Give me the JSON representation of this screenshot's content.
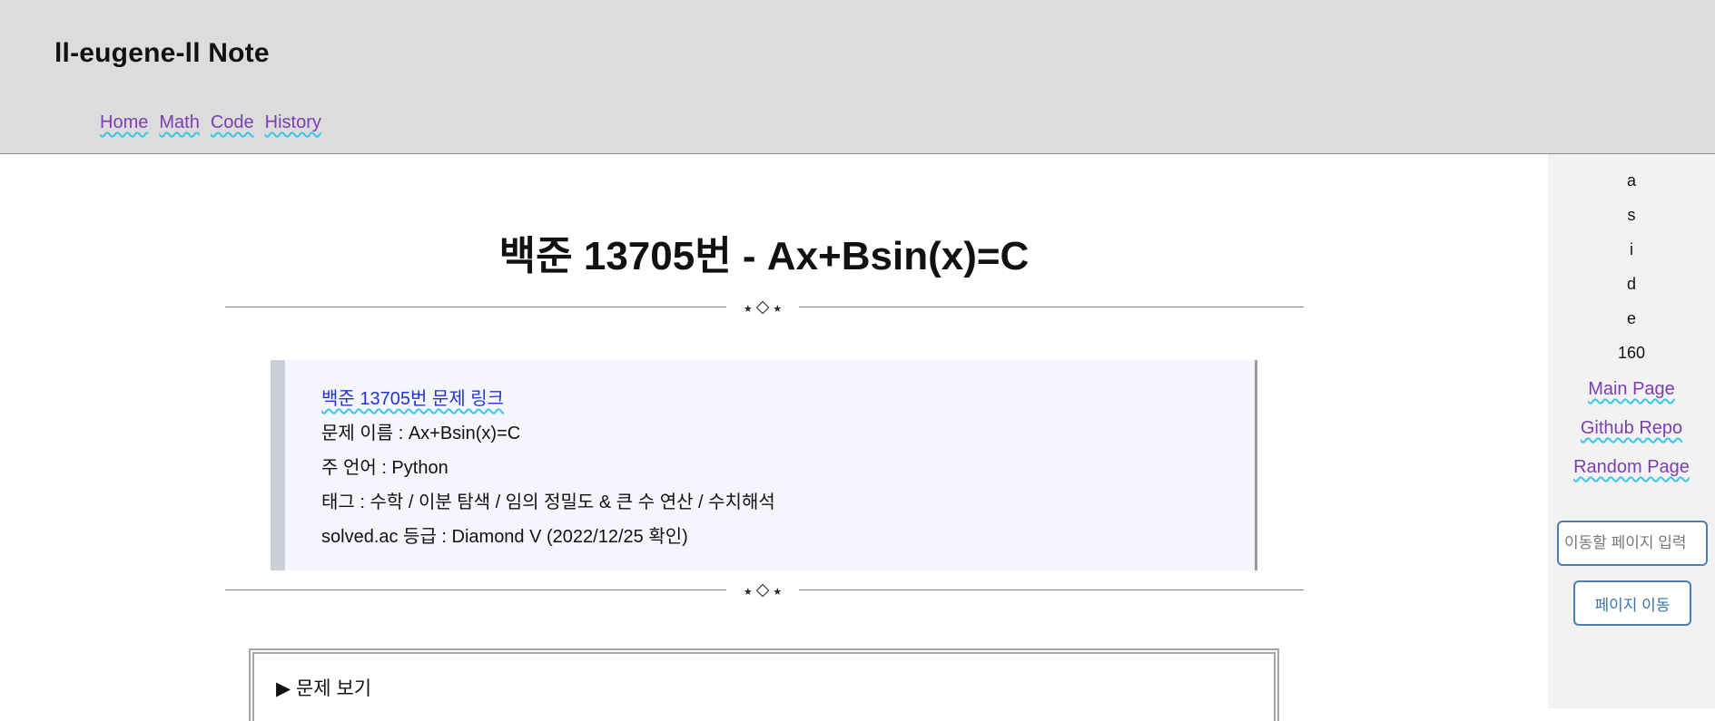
{
  "header": {
    "title": "ll-eugene-ll Note",
    "nav": [
      "Home",
      "Math",
      "Code",
      "History"
    ]
  },
  "aside": {
    "letters": [
      "a",
      "s",
      "i",
      "d",
      "e",
      "160"
    ],
    "links": [
      "Main Page",
      "Github Repo",
      "Random Page"
    ],
    "input_placeholder": "이동할 페이지 입력",
    "go_button": "페이지 이동"
  },
  "post": {
    "title": "백준 13705번 - Ax+Bsin(x)=C",
    "divider": {
      "star": "★",
      "diamond": "◇"
    },
    "info": {
      "link_text": "백준 13705번 문제 링크",
      "problem_name": "문제 이름 : Ax+Bsin(x)=C",
      "language": "주 언어 : Python",
      "tags": "태그 : 수학 / 이분 탐색 / 임의 정밀도 & 큰 수 연산 / 수치해석",
      "grade": "solved.ac 등급 : Diamond V (2022/12/25 확인)"
    },
    "details_summary": "▶ 문제 보기"
  },
  "colors": {
    "header_bg": "#dcdcdc",
    "aside_bg": "#f2f2f2",
    "link_visited": "#7b3fb0",
    "link": "#2234d8",
    "info_bg": "#f5f6fd",
    "button_border": "#4a7fb0"
  }
}
